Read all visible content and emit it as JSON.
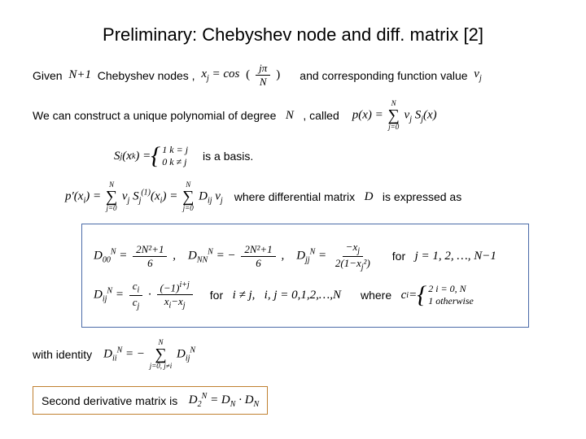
{
  "title": "Preliminary: Chebyshev node and diff. matrix  [2]",
  "l1a": "Given",
  "l1b": "Chebyshev nodes   ,",
  "l1c": "and corresponding function value",
  "l2a": "We can construct a unique polynomial of degree",
  "l2b": ", called",
  "l3": "is a basis.",
  "l4a": "where differential matrix",
  "l4b": "is expressed as",
  "box_for1": "for",
  "box_for2": "for",
  "box_where": "where",
  "id1": "with identity",
  "sd": "Second derivative matrix is",
  "m": {
    "Np1": "N + 1",
    "xj": "x_j = cos( jπ / N )",
    "vj": "v_j",
    "N": "N",
    "px": "p(x) =",
    "vjSj": "v_j S_j(x)",
    "Sjxk": "S_j(x_k) =",
    "case1": "1  k = j",
    "case0": "0  k ≠ j",
    "ppxi": "p′(x_i) =",
    "sum1": "v_j S_j^(1)(x_i) =",
    "Dijvj": "D_ij v_j",
    "D": "D",
    "D00": "D_00^N =",
    "D00v": "(2N² + 1) / 6",
    "DNN": "D_NN^N =  −",
    "DNNv": "(2N² + 1) / 6",
    "Djj": "D_jj^N =",
    "Djjv": "−x_j / 2(1 − x_j²)",
    "jrange": "j = 1, 2, …, N − 1",
    "Dij": "D_ij^N =",
    "Dijv": "(c_i / c_j) · (−1)^(i+j) / (x_i − x_j)",
    "ineq": "i ≠ j,   i, j = 0, 1, 2, …, N",
    "ci": "c_i =",
    "ci2": "2   i = 0, N",
    "ci1": "1   otherwise",
    "Dii": "D_ii^N = −",
    "DiiSum": "D_ij^N",
    "D2": "D_2^N = D_N · D_N"
  }
}
